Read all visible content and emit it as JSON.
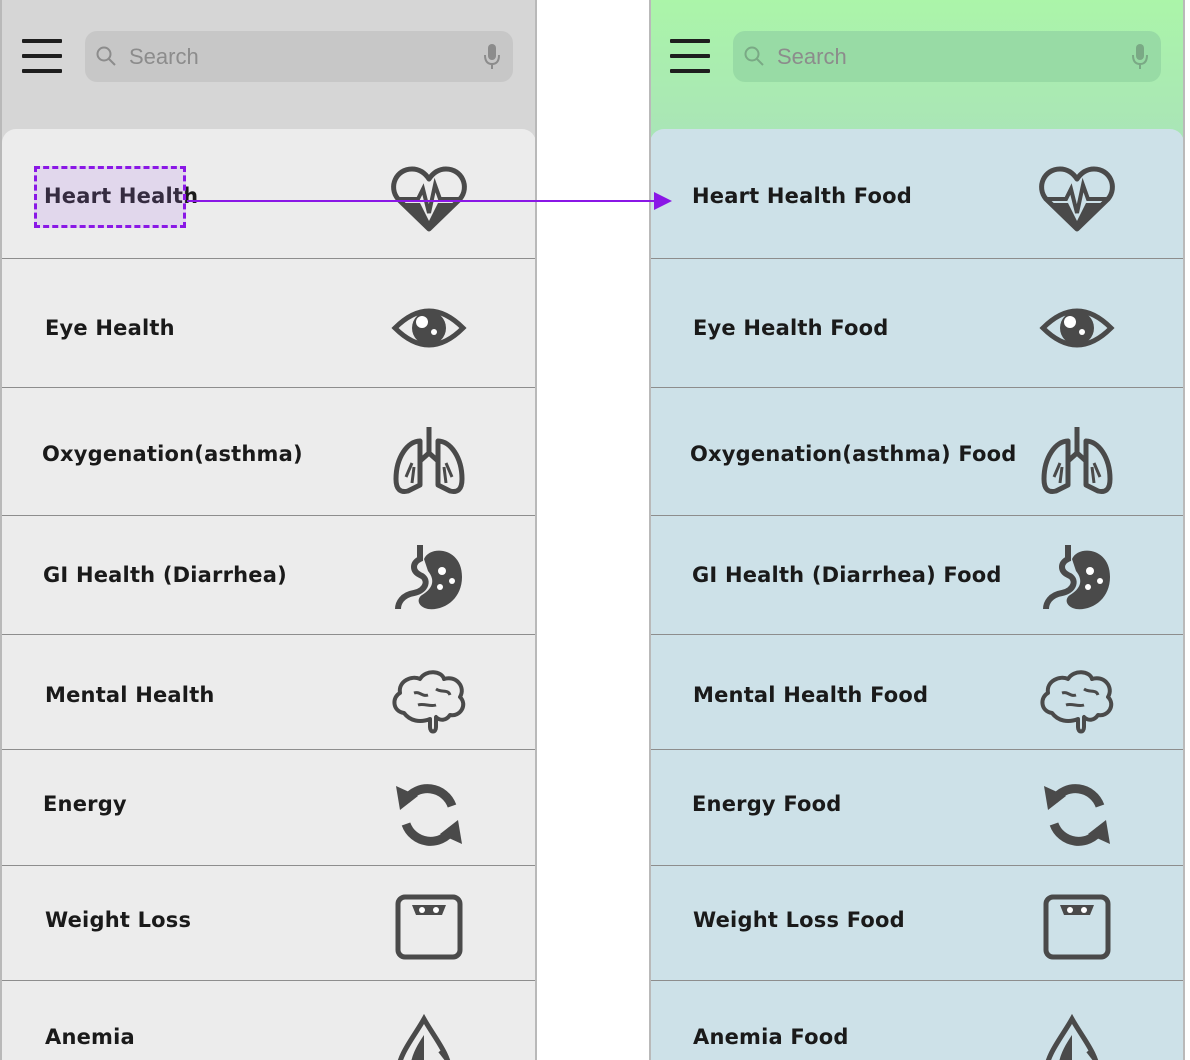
{
  "screens": [
    {
      "id": "left",
      "search": {
        "placeholder": "Search"
      },
      "items": [
        {
          "label": "Heart Health",
          "icon": "heart-pulse-icon"
        },
        {
          "label": "Eye Health",
          "icon": "eye-icon"
        },
        {
          "label": "Oxygenation(asthma)",
          "icon": "lungs-icon"
        },
        {
          "label": "GI Health (Diarrhea)",
          "icon": "stomach-icon"
        },
        {
          "label": "Mental Health",
          "icon": "brain-icon"
        },
        {
          "label": "Energy",
          "icon": "refresh-icon"
        },
        {
          "label": "Weight Loss",
          "icon": "scale-icon"
        },
        {
          "label": "Anemia",
          "icon": "blood-drop-icon"
        }
      ]
    },
    {
      "id": "right",
      "search": {
        "placeholder": "Search"
      },
      "items": [
        {
          "label": "Heart Health Food",
          "icon": "heart-pulse-icon"
        },
        {
          "label": "Eye Health Food",
          "icon": "eye-icon"
        },
        {
          "label": "Oxygenation(asthma) Food",
          "icon": "lungs-icon"
        },
        {
          "label": "GI Health (Diarrhea) Food",
          "icon": "stomach-icon"
        },
        {
          "label": "Mental Health Food",
          "icon": "brain-icon"
        },
        {
          "label": "Energy Food",
          "icon": "refresh-icon"
        },
        {
          "label": "Weight Loss Food",
          "icon": "scale-icon"
        },
        {
          "label": "Anemia Food",
          "icon": "blood-drop-icon"
        }
      ]
    }
  ],
  "colors": {
    "left_header": "#d6d6d6",
    "left_list": "#ececec",
    "right_header": "#abf5a9",
    "right_list": "#cde1e8",
    "highlight": "#8a17e6",
    "icon": "#4a4a4a"
  }
}
